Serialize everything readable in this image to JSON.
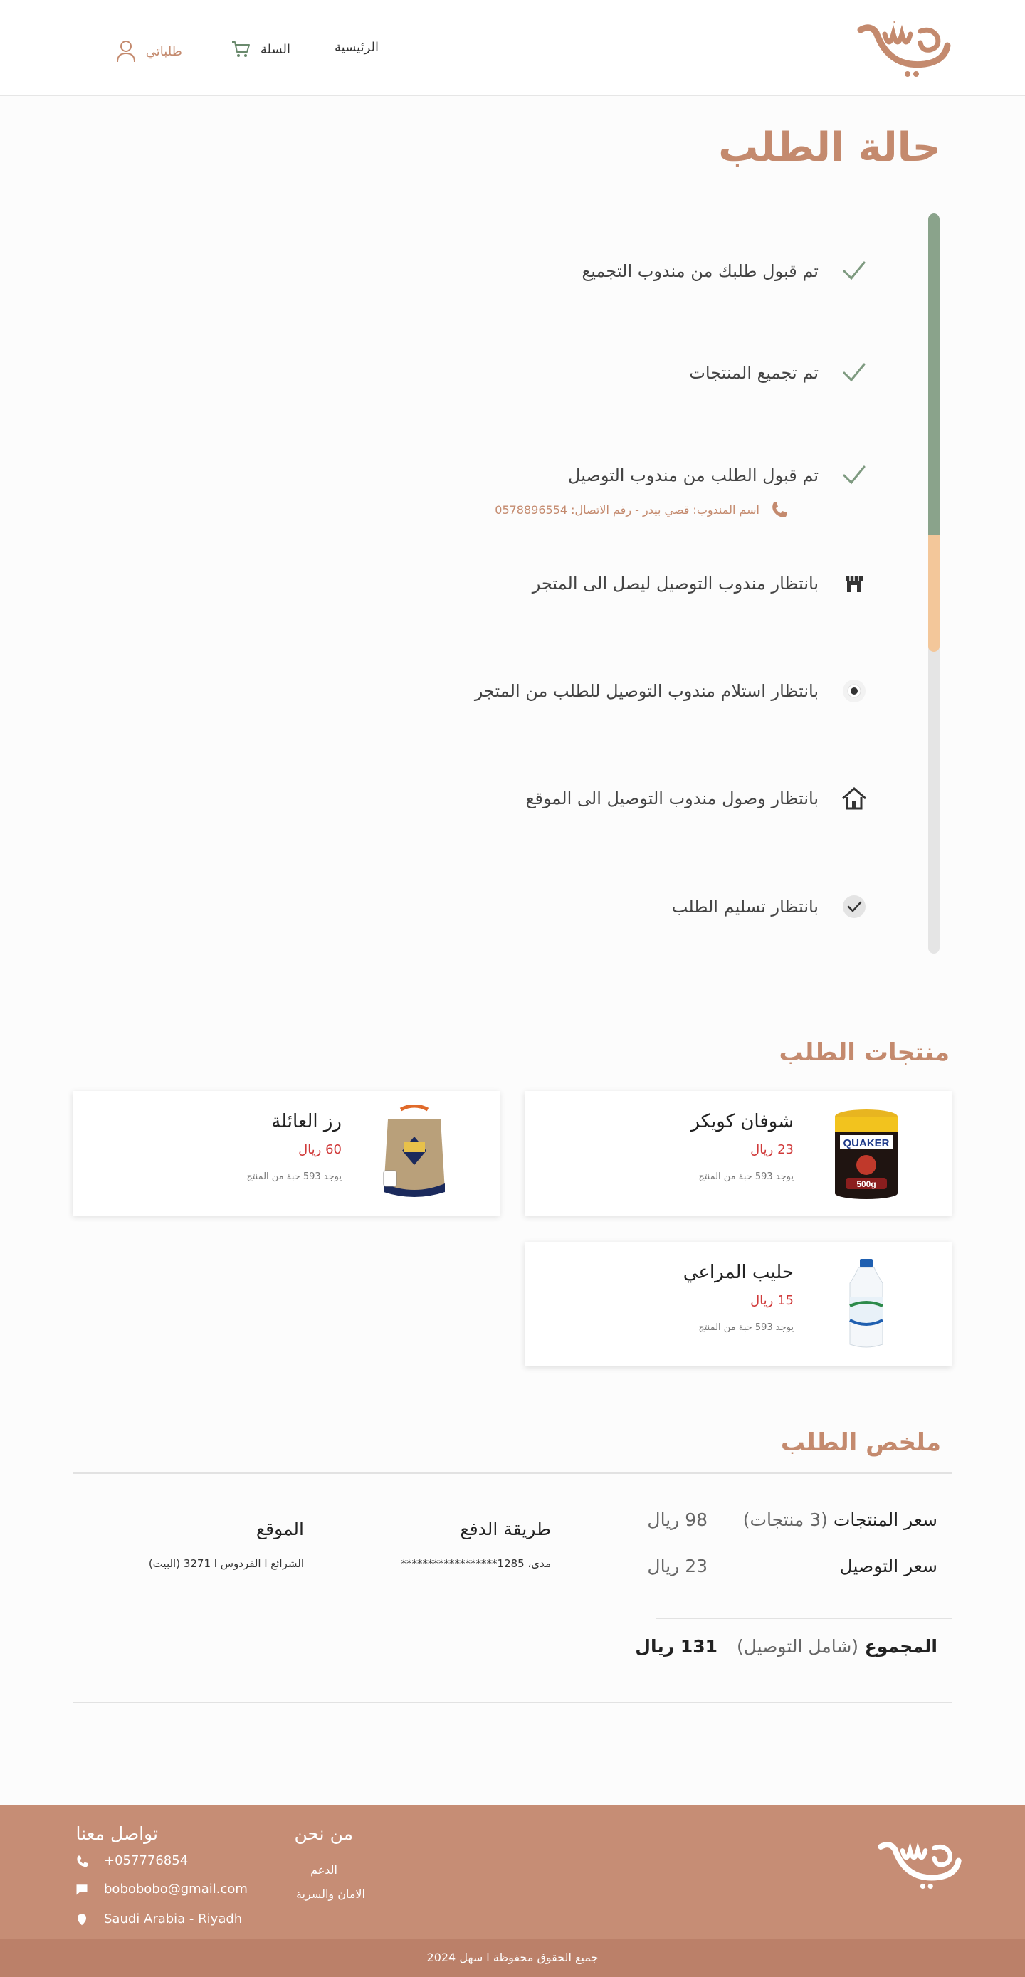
{
  "header": {
    "logo_text": "سهل",
    "nav": {
      "home": "الرئيسية",
      "cart": "السلة",
      "orders": "طلباتي"
    }
  },
  "order_status": {
    "title": "حالة الطلب",
    "steps": [
      {
        "label": "تم قبول طلبك من مندوب التجميع",
        "state": "done",
        "icon": "check-icon"
      },
      {
        "label": "تم تجميع المنتجات",
        "state": "done",
        "icon": "check-icon"
      },
      {
        "label": "تم قبول الطلب من مندوب التوصيل",
        "state": "done",
        "icon": "check-icon"
      },
      {
        "label": "بانتظار  مندوب التوصيل ليصل الى المتجر",
        "state": "current",
        "icon": "store-icon"
      },
      {
        "label": "بانتظار استلام مندوب التوصيل للطلب من المتجر",
        "state": "pending",
        "icon": "pickup-icon"
      },
      {
        "label": "بانتظار وصول مندوب التوصيل الى الموقع",
        "state": "pending",
        "icon": "home-icon"
      },
      {
        "label": "بانتظار تسليم الطلب",
        "state": "pending",
        "icon": "delivered-check-icon"
      }
    ],
    "agent_info": "اسم المندوب: قصي بيدر - رقم الاتصال: 0578896554",
    "progress_colors": {
      "done": "#8aa38b",
      "current": "#f3c79a",
      "pending": "#e5e5e5"
    }
  },
  "products": {
    "title": "منتجات الطلب",
    "items": [
      {
        "name": "شوفان كويكر",
        "price": "23 ريال",
        "stock": "يوجد 593 حبة من المنتج",
        "image": "quaker-oats-tin"
      },
      {
        "name": "رز العائلة",
        "price": "60 ريال",
        "stock": "يوجد 593 حبة من المنتج",
        "image": "rice-bag"
      },
      {
        "name": "حليب المراعي",
        "price": "15 ريال",
        "stock": "يوجد 593 حبة من المنتج",
        "image": "milk-bottle"
      }
    ]
  },
  "summary": {
    "title": "ملخص الطلب",
    "products_price_label": "سعر المنتجات",
    "products_count": "(3 منتجات)",
    "products_price": "98 ريال",
    "delivery_label": "سعر التوصيل",
    "delivery_price": "23 ريال",
    "total_label": "المجموع",
    "total_sub": "(شامل التوصيل)",
    "total_value": "131 ريال",
    "payment_label": "طريقة الدفع",
    "payment_value": "مدى، 1285******************",
    "location_label": "الموقع",
    "location_value": "الشرائع ا الفردوس ا 3271 (البيت)"
  },
  "footer": {
    "logo_text": "سهل",
    "about_title": "من نحن",
    "support": "الدعم",
    "privacy": "الامان والسرية",
    "contact_title": "تواصل معنا",
    "phone": "+057776854",
    "email": "bobobobo@gmail.com",
    "address": "Saudi Arabia - Riyadh",
    "copyright": "جميع الحقوق محفوظة ا سهل 2024",
    "bg_color": "#c68d75"
  },
  "colors": {
    "accent": "#c48a6e",
    "price_red": "#d03a3a"
  }
}
